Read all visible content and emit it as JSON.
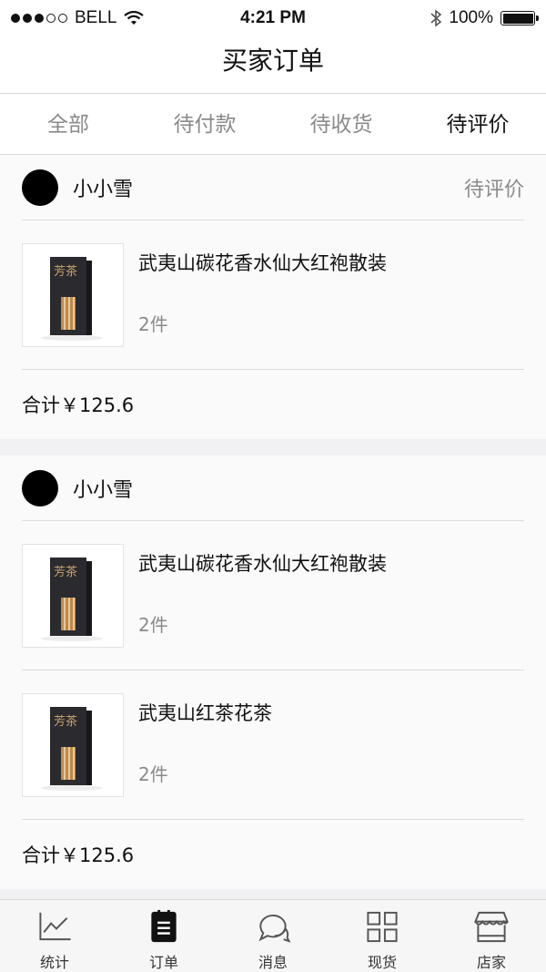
{
  "status_bar": {
    "carrier": "BELL",
    "time": "4:21 PM",
    "battery": "100%"
  },
  "nav": {
    "title": "买家订单"
  },
  "tabs": [
    {
      "label": "全部",
      "active": false
    },
    {
      "label": "待付款",
      "active": false
    },
    {
      "label": "待收货",
      "active": false
    },
    {
      "label": "待评价",
      "active": true
    }
  ],
  "orders": [
    {
      "buyer": "小小雪",
      "status": "待评价",
      "items": [
        {
          "name": "武夷山碳花香水仙大红袍散装",
          "qty": "2件",
          "image": "tea-box-icon"
        }
      ],
      "total": "合计￥125.6"
    },
    {
      "buyer": "小小雪",
      "status": "",
      "items": [
        {
          "name": "武夷山碳花香水仙大红袍散装",
          "qty": "2件",
          "image": "tea-box-icon"
        },
        {
          "name": "武夷山红茶花茶",
          "qty": "2件",
          "image": "tea-box-icon"
        }
      ],
      "total": "合计￥125.6"
    }
  ],
  "product_image_text": "芳茶",
  "tabbar": [
    {
      "label": "统计",
      "icon": "chart-icon"
    },
    {
      "label": "订单",
      "icon": "order-icon"
    },
    {
      "label": "消息",
      "icon": "message-icon"
    },
    {
      "label": "现货",
      "icon": "grid-icon"
    },
    {
      "label": "店家",
      "icon": "store-icon"
    }
  ]
}
